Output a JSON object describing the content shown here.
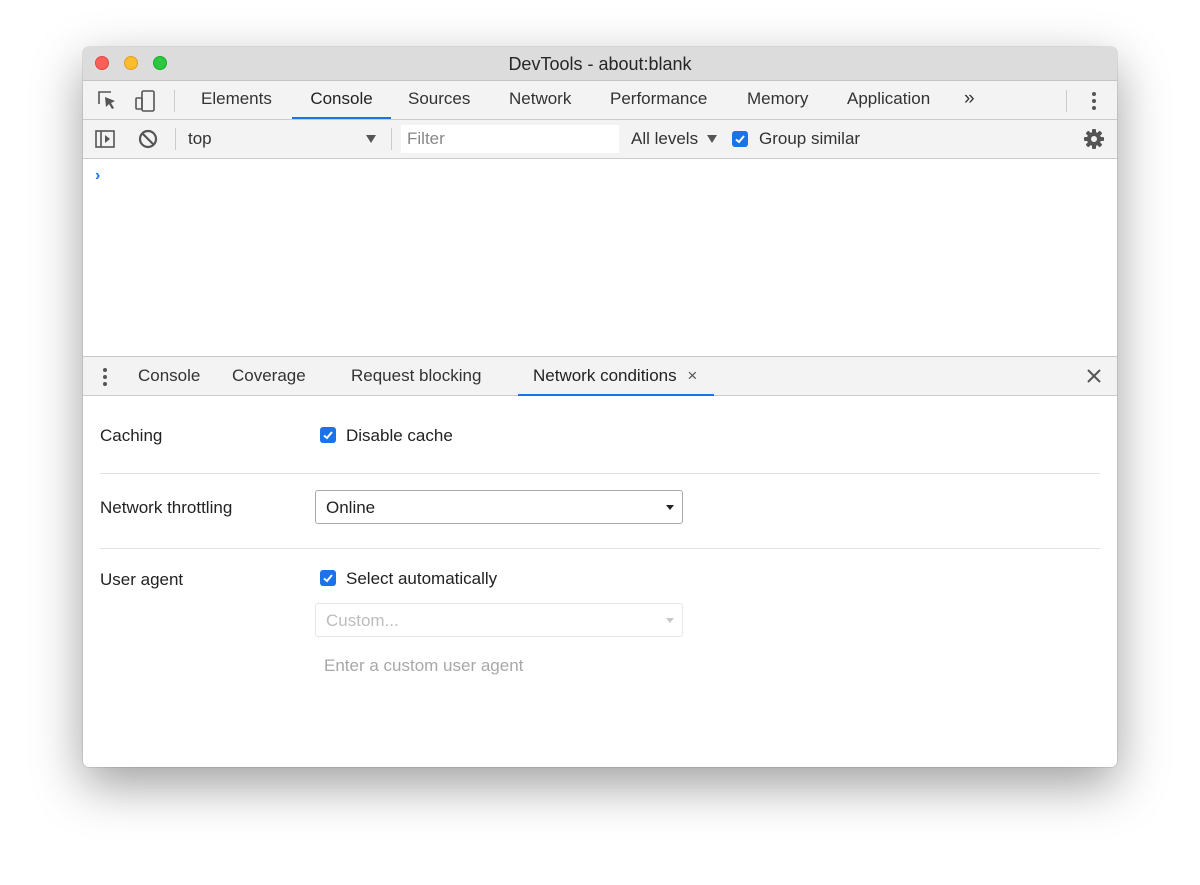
{
  "window": {
    "title": "DevTools - about:blank"
  },
  "main_tabs": [
    "Elements",
    "Console",
    "Sources",
    "Network",
    "Performance",
    "Memory",
    "Application"
  ],
  "main_tabs_active": "Console",
  "more_tabs_glyph": "»",
  "console_toolbar": {
    "context": "top",
    "filter_placeholder": "Filter",
    "levels": "All levels",
    "group_similar": {
      "label": "Group similar",
      "checked": true
    }
  },
  "console": {
    "prompt": "›"
  },
  "drawer": {
    "tabs": [
      "Console",
      "Coverage",
      "Request blocking",
      "Network conditions"
    ],
    "active_tab": "Network conditions",
    "tab_close_glyph": "×"
  },
  "network_conditions": {
    "caching": {
      "label": "Caching",
      "checkbox_label": "Disable cache",
      "checked": true
    },
    "throttling": {
      "label": "Network throttling",
      "value": "Online"
    },
    "user_agent": {
      "label": "User agent",
      "checkbox_label": "Select automatically",
      "checked": true,
      "select_value": "Custom...",
      "input_placeholder": "Enter a custom user agent"
    }
  },
  "icons": {
    "inspect": "inspect-element-icon",
    "device": "device-toolbar-icon",
    "kebab": "more-vertical-icon",
    "sidebar": "show-sidebar-icon",
    "clear": "clear-console-icon",
    "settings": "gear-icon",
    "drawer_menu": "drawer-menu-icon",
    "close_drawer": "close-icon"
  },
  "colors": {
    "accent": "#1a73e8",
    "toolbar_bg": "#f3f3f3",
    "titlebar_bg": "#dcdcdc"
  }
}
